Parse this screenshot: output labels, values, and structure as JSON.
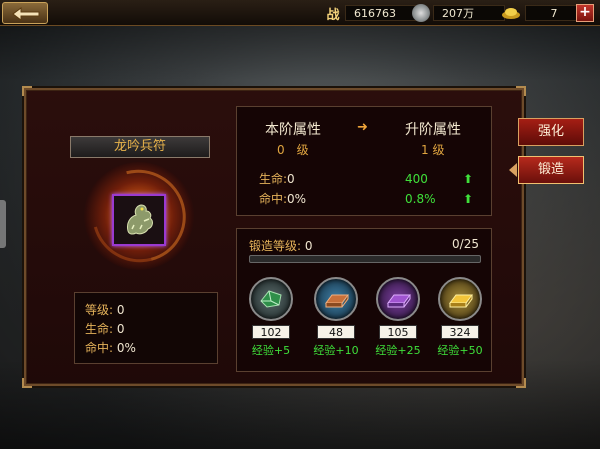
{
  "topbar": {
    "power_icon": "战",
    "power_value": "616763",
    "silver_value": "207万",
    "gold_value": "7",
    "plus_label": "+"
  },
  "item": {
    "name": "龙吟兵符",
    "stats": [
      {
        "label": "等级:",
        "value": "0"
      },
      {
        "label": "生命:",
        "value": "0"
      },
      {
        "label": "命中:",
        "value": "0%"
      }
    ]
  },
  "attributes": {
    "current_header": "本阶属性",
    "next_header": "升阶属性",
    "arrow": "➜",
    "current_level": "0　级",
    "next_level": "1 级",
    "rows": [
      {
        "label": "生命:",
        "current": "0",
        "next": "400",
        "up": "⬆"
      },
      {
        "label": "命中:",
        "current": "0%",
        "next": "0.8%",
        "up": "⬆"
      }
    ]
  },
  "forge": {
    "level_label": "锻造等级:",
    "level_value": "0",
    "progress_text": "0/25",
    "progress": 0,
    "materials": [
      {
        "count": "102",
        "exp": "经验+5"
      },
      {
        "count": "48",
        "exp": "经验+10"
      },
      {
        "count": "105",
        "exp": "经验+25"
      },
      {
        "count": "324",
        "exp": "经验+50"
      }
    ]
  },
  "tabs": {
    "strengthen": "强化",
    "forge": "锻造"
  }
}
